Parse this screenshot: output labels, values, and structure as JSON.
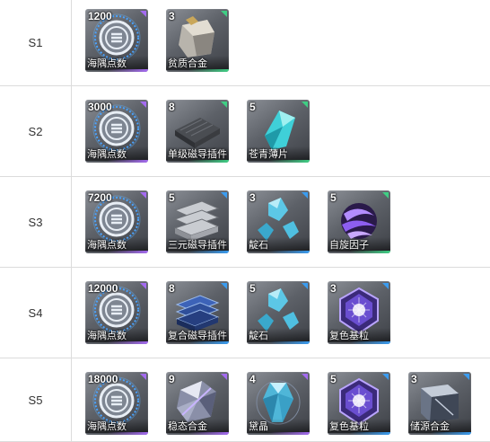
{
  "colors": {
    "purple": "#a46bf0",
    "green": "#3fce84",
    "blue": "#3a9cf0"
  },
  "rows": [
    {
      "stage": "S1",
      "items": [
        {
          "qty": "1200",
          "name": "海隅点数",
          "tier": "purple",
          "icon": "coin-emblem-icon"
        },
        {
          "qty": "3",
          "name": "贫质合金",
          "tier": "green",
          "icon": "alloy-chunk-icon"
        }
      ]
    },
    {
      "stage": "S2",
      "items": [
        {
          "qty": "3000",
          "name": "海隅点数",
          "tier": "purple",
          "icon": "coin-emblem-icon"
        },
        {
          "qty": "8",
          "name": "单级磁导插件",
          "tier": "green",
          "icon": "magnetic-plate-icon"
        },
        {
          "qty": "5",
          "name": "苍青薄片",
          "tier": "green",
          "icon": "cyan-shard-icon"
        }
      ]
    },
    {
      "stage": "S3",
      "items": [
        {
          "qty": "7200",
          "name": "海隅点数",
          "tier": "purple",
          "icon": "coin-emblem-icon"
        },
        {
          "qty": "5",
          "name": "三元磁导插件",
          "tier": "blue",
          "icon": "triple-plate-icon"
        },
        {
          "qty": "3",
          "name": "靛石",
          "tier": "blue",
          "icon": "indigo-crystal-icon"
        },
        {
          "qty": "5",
          "name": "自旋因子",
          "tier": "green",
          "icon": "spin-orb-icon"
        }
      ]
    },
    {
      "stage": "S4",
      "items": [
        {
          "qty": "12000",
          "name": "海隅点数",
          "tier": "purple",
          "icon": "coin-emblem-icon"
        },
        {
          "qty": "8",
          "name": "复合磁导插件",
          "tier": "blue",
          "icon": "composite-plate-icon"
        },
        {
          "qty": "5",
          "name": "靛石",
          "tier": "blue",
          "icon": "indigo-crystal-icon"
        },
        {
          "qty": "3",
          "name": "复色基粒",
          "tier": "blue",
          "icon": "polychrome-gem-icon"
        }
      ]
    },
    {
      "stage": "S5",
      "items": [
        {
          "qty": "18000",
          "name": "海隅点数",
          "tier": "purple",
          "icon": "coin-emblem-icon"
        },
        {
          "qty": "9",
          "name": "稳态合金",
          "tier": "purple",
          "icon": "stable-alloy-icon"
        },
        {
          "qty": "4",
          "name": "黛晶",
          "tier": "purple",
          "icon": "dark-crystal-icon"
        },
        {
          "qty": "5",
          "name": "复色基粒",
          "tier": "blue",
          "icon": "polychrome-gem-icon"
        },
        {
          "qty": "3",
          "name": "储源合金",
          "tier": "blue",
          "icon": "source-alloy-icon"
        }
      ]
    }
  ]
}
